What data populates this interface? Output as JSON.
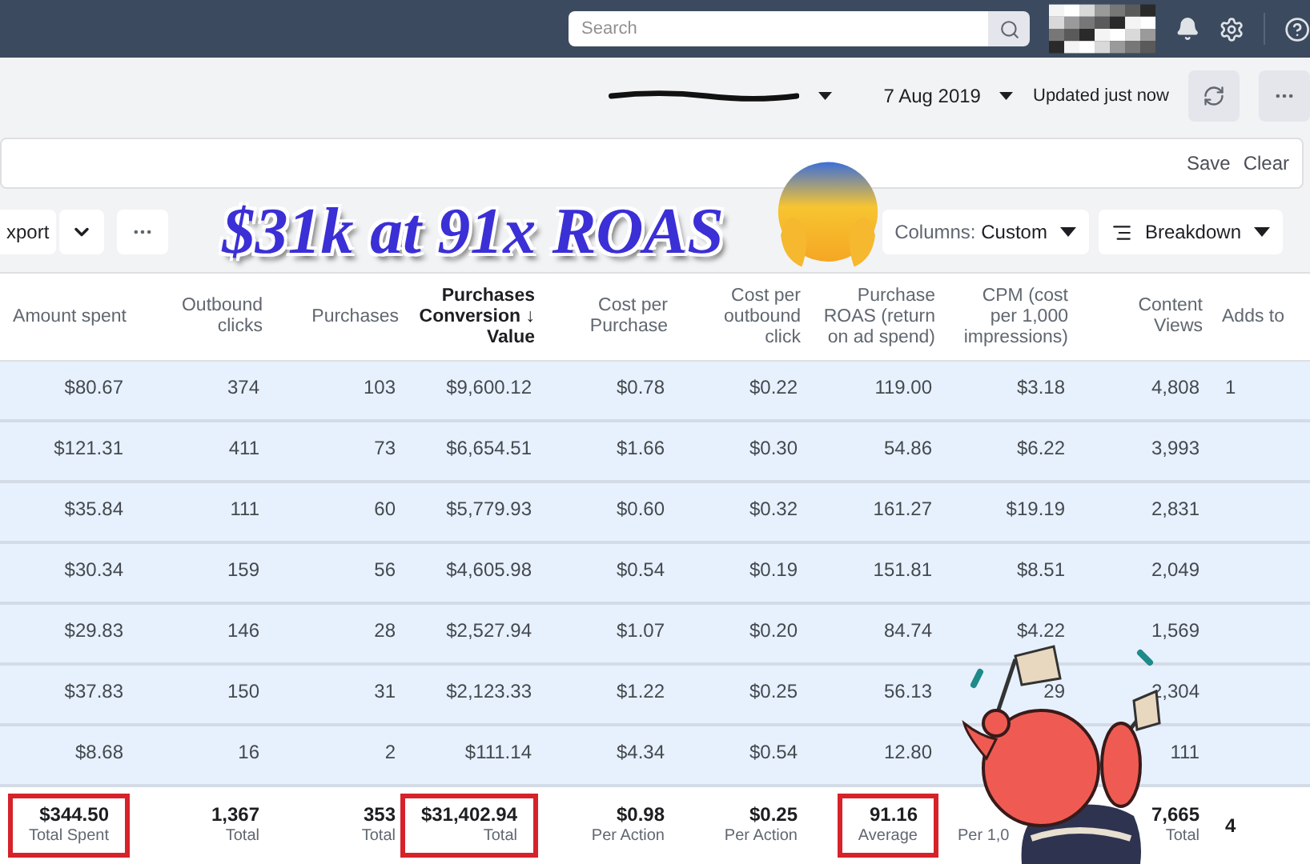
{
  "topbar": {
    "search": {
      "placeholder": "Search"
    }
  },
  "header": {
    "date": "7 Aug 2019",
    "status": "Updated just now"
  },
  "filter_bar": {
    "actions": [
      "Save",
      "Clear"
    ]
  },
  "toolbar": {
    "export": "xport",
    "columns_label": "Columns:",
    "columns_value": "Custom",
    "breakdown": "Breakdown",
    "headline": "$31k at 91x ROAS"
  },
  "table": {
    "columns": [
      {
        "label": "Amount spent",
        "sorted": false
      },
      {
        "label": "Outbound clicks",
        "sorted": false
      },
      {
        "label": "Purchases",
        "sorted": false
      },
      {
        "label": "Purchases Conversion ↓ Value",
        "sorted": true
      },
      {
        "label": "Cost per Purchase",
        "sorted": false
      },
      {
        "label": "Cost per outbound click",
        "sorted": false
      },
      {
        "label": "Purchase ROAS (return on ad spend)",
        "sorted": false
      },
      {
        "label": "CPM (cost per 1,000 impressions)",
        "sorted": false
      },
      {
        "label": "Content Views",
        "sorted": false
      },
      {
        "label": "Adds to",
        "sorted": false
      }
    ],
    "rows": [
      [
        "$80.67",
        "374",
        "103",
        "$9,600.12",
        "$0.78",
        "$0.22",
        "119.00",
        "$3.18",
        "4,808",
        "1"
      ],
      [
        "$121.31",
        "411",
        "73",
        "$6,654.51",
        "$1.66",
        "$0.30",
        "54.86",
        "$6.22",
        "3,993",
        null
      ],
      [
        "$35.84",
        "111",
        "60",
        "$5,779.93",
        "$0.60",
        "$0.32",
        "161.27",
        "$19.19",
        "2,831",
        null
      ],
      [
        "$30.34",
        "159",
        "56",
        "$4,605.98",
        "$0.54",
        "$0.19",
        "151.81",
        "$8.51",
        "2,049",
        null
      ],
      [
        "$29.83",
        "146",
        "28",
        "$2,527.94",
        "$1.07",
        "$0.20",
        "84.74",
        "$4.22",
        "1,569",
        null
      ],
      [
        "$37.83",
        "150",
        "31",
        "$2,123.33",
        "$1.22",
        "$0.25",
        "56.13",
        "29",
        "2,304",
        null
      ],
      [
        "$8.68",
        "16",
        "2",
        "$111.14",
        "$4.34",
        "$0.54",
        "12.80",
        null,
        "111",
        null
      ]
    ],
    "totals": [
      {
        "value": "$344.50",
        "label": "Total Spent",
        "highlighted": true
      },
      {
        "value": "1,367",
        "label": "Total",
        "highlighted": false
      },
      {
        "value": "353",
        "label": "Total",
        "highlighted": false
      },
      {
        "value": "$31,402.94",
        "label": "Total",
        "highlighted": true
      },
      {
        "value": "$0.98",
        "label": "Per Action",
        "highlighted": false
      },
      {
        "value": "$0.25",
        "label": "Per Action",
        "highlighted": false
      },
      {
        "value": "91.16",
        "label": "Average",
        "highlighted": true
      },
      {
        "label": "Per 1,0",
        "highlighted": false
      },
      {
        "value": "7,665",
        "label": "Total",
        "highlighted": false
      },
      {
        "value": "4",
        "highlighted": false
      }
    ]
  }
}
